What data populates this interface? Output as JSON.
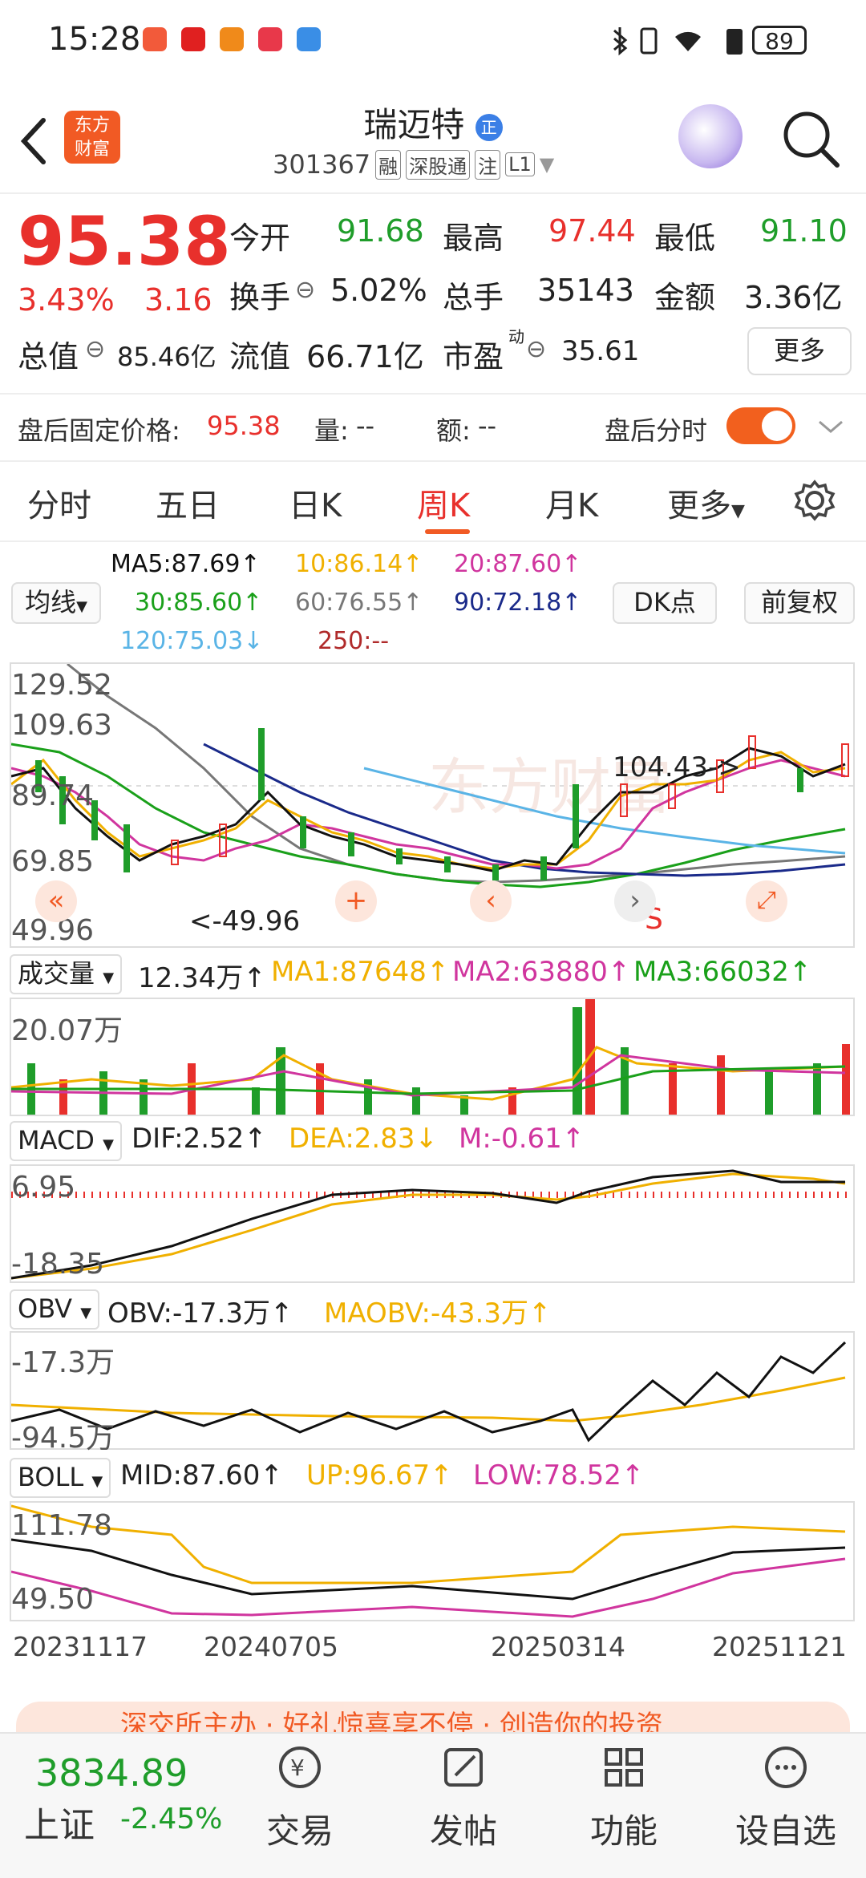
{
  "status": {
    "time": "15:28",
    "battery": "89"
  },
  "header": {
    "logo_line1": "东方",
    "logo_line2": "财富",
    "title": "瑞迈特",
    "title_badge": "正",
    "code": "301367",
    "tags": [
      "融",
      "深股通",
      "注",
      "L1"
    ]
  },
  "quote": {
    "price": "95.38",
    "change_pct": "3.43%",
    "change": "3.16",
    "fields": {
      "open_label": "今开",
      "open": "91.68",
      "high_label": "最高",
      "high": "97.44",
      "low_label": "最低",
      "low": "91.10",
      "turnover_label": "换手",
      "turnover": "5.02%",
      "volume_label": "总手",
      "volume": "35143",
      "amount_label": "金额",
      "amount": "3.36亿",
      "mktcap_label": "总值",
      "mktcap": "85.46亿",
      "float_label": "流值",
      "float": "66.71亿",
      "pe_label": "市盈",
      "pe_sup": "动",
      "pe": "35.61"
    },
    "more": "更多"
  },
  "after_hours": {
    "label": "盘后固定价格:",
    "price": "95.38",
    "vol_label": "量:",
    "vol": "--",
    "amt_label": "额:",
    "amt": "--",
    "toggle_label": "盘后分时"
  },
  "tabs": [
    "分时",
    "五日",
    "日K",
    "周K",
    "月K",
    "更多"
  ],
  "ma_legend": {
    "selector": "均线",
    "ma5": "MA5:87.69↑",
    "ma10": "10:86.14↑",
    "ma20": "20:87.60↑",
    "ma30": "30:85.60↑",
    "ma60": "60:76.55↑",
    "ma90": "90:72.18↑",
    "ma120": "120:75.03↓",
    "ma250": "250:--",
    "dk_button": "DK点",
    "adjust_button": "前复权"
  },
  "kline": {
    "axis": [
      "129.52",
      "109.63",
      "89.74",
      "69.85",
      "49.96"
    ],
    "high_annot": "104.43->",
    "low_annot": "<-49.96",
    "signal": "S",
    "watermark": "东方财富"
  },
  "volume": {
    "selector": "成交量",
    "value": "12.34万↑",
    "ma1": "MA1:87648↑",
    "ma2": "MA2:63880↑",
    "ma3": "MA3:66032↑",
    "axis": "20.07万"
  },
  "macd": {
    "selector": "MACD",
    "dif": "DIF:2.52↑",
    "dea": "DEA:2.83↓",
    "m": "M:-0.61↑",
    "axis_top": "6.95",
    "axis_bottom": "-18.35"
  },
  "obv": {
    "selector": "OBV",
    "obv": "OBV:-17.3万↑",
    "maobv": "MAOBV:-43.3万↑",
    "axis_top": "-17.3万",
    "axis_bottom": "-94.5万"
  },
  "boll": {
    "selector": "BOLL",
    "mid": "MID:87.60↑",
    "up": "UP:96.67↑",
    "low": "LOW:78.52↑",
    "axis_top": "111.78",
    "axis_bottom": "49.50"
  },
  "dates": [
    "20231117",
    "20240705",
    "20250314",
    "20251121"
  ],
  "ad_text": "深交所主办 · 好礼惊喜享不停 · 创造你的投资",
  "bottom": {
    "index_value": "3834.89",
    "index_name": "上证",
    "index_change": "-2.45%",
    "nav": [
      "交易",
      "发帖",
      "功能",
      "设自选"
    ]
  },
  "colors": {
    "up": "#e8302c",
    "down": "#1f9d2a",
    "accent": "#f15a24",
    "ma5": "#111111",
    "ma10": "#f0b000",
    "ma20": "#d0359e",
    "ma30": "#1aa01a",
    "ma60": "#777777",
    "ma90": "#1a2a8a",
    "ma120": "#5ab4e6"
  }
}
